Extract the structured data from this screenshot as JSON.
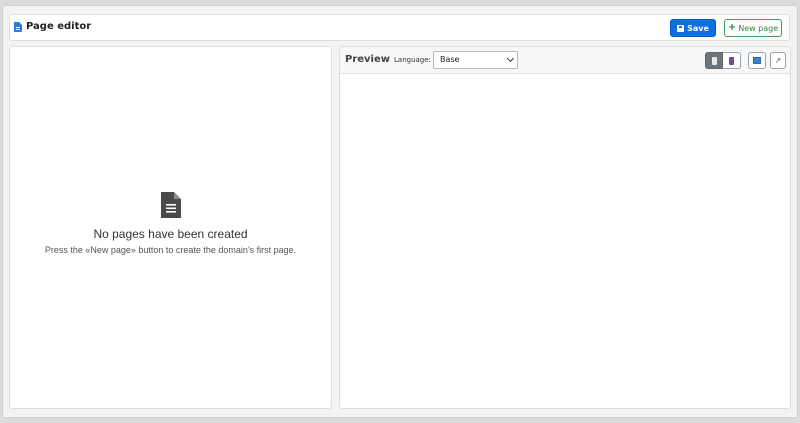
{
  "header": {
    "title": "Page editor",
    "save_label": "Save",
    "new_page_label": "New page",
    "title_icon": "file-icon",
    "save_icon": "floppy-disk-icon",
    "new_icon": "plus-icon"
  },
  "left_panel": {
    "empty_icon": "document-icon",
    "empty_title": "No pages have been created",
    "empty_text": "Press the «New page» button to create the domain's first page."
  },
  "preview": {
    "title": "Preview",
    "language_label": "Language:",
    "language_value": "Base",
    "tools": {
      "mobile_light": "mobile-light-icon",
      "mobile_dark": "mobile-dark-icon",
      "desktop": "desktop-icon",
      "external": "external-link-icon"
    }
  },
  "colors": {
    "primary": "#0d6ede",
    "success": "#2e8540",
    "active_tool": "#6c757d"
  }
}
